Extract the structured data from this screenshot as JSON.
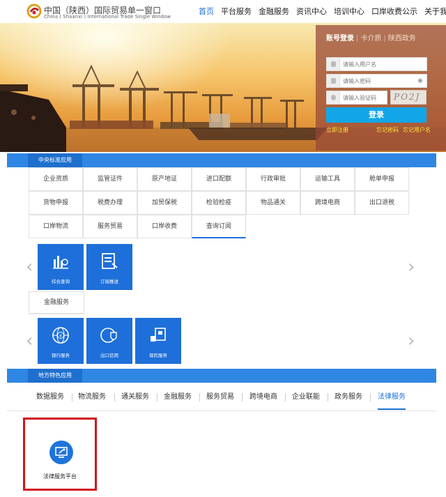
{
  "header": {
    "logo_cn": "中国（陕西）国际贸易单一窗口",
    "logo_en": "China ( Shaanxi ) International Trade Single Window",
    "nav": [
      {
        "label": "首页",
        "active": true
      },
      {
        "label": "平台服务"
      },
      {
        "label": "金融服务"
      },
      {
        "label": "资讯中心"
      },
      {
        "label": "培训中心"
      },
      {
        "label": "口岸收费公示"
      },
      {
        "label": "关于我们"
      }
    ]
  },
  "login": {
    "tabs": [
      "账号登录",
      "卡介质",
      "陕西政务"
    ],
    "username_placeholder": "请输入用户名",
    "password_placeholder": "请输入密码",
    "captcha_placeholder": "请输入验证码",
    "captcha_text": "PO2J",
    "submit_label": "登录",
    "register_label": "立即注册",
    "forgot_password_label": "忘记密码",
    "forgot_username_label": "忘记用户名"
  },
  "central": {
    "section_title": "中央标准应用",
    "rows": [
      [
        "企业资质",
        "监管证件",
        "原产地证",
        "进口配额",
        "行政审批",
        "运输工具",
        "舱单申报"
      ],
      [
        "货物申报",
        "税费办理",
        "加贸保税",
        "检验检疫",
        "物品通关",
        "跨境电商",
        "出口退税"
      ],
      [
        "口岸物流",
        "服务贸易",
        "口岸收费",
        "查询订阅"
      ]
    ],
    "selected": "查询订阅",
    "tiles": [
      "综合查询",
      "订阅推送"
    ],
    "finance_tab": "金融服务",
    "finance_tiles": [
      "银行服务",
      "出口信用",
      "保险服务"
    ]
  },
  "local": {
    "section_title": "地方特色应用",
    "tabs": [
      "数据服务",
      "物流服务",
      "通关服务",
      "金融服务",
      "服务贸易",
      "跨境电商",
      "企业联能",
      "政务服务",
      "法律服务"
    ],
    "active_tab": "法律服务",
    "card_label": "法律服务平台"
  },
  "colors": {
    "primary": "#1a6fd6",
    "bar": "#2f86e3",
    "tile": "#1e6fd9",
    "login_button": "#12a6e8",
    "highlight": "#d2131d"
  }
}
